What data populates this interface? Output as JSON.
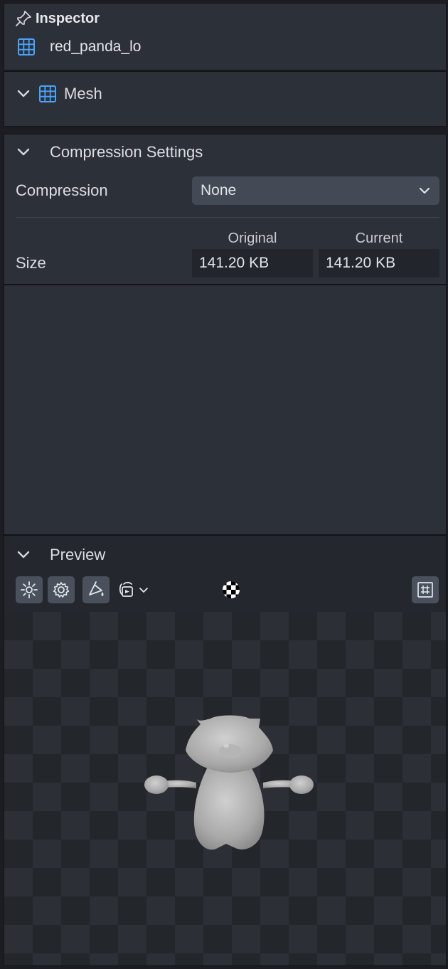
{
  "inspector": {
    "title": "Inspector",
    "asset_name": "red_panda_lo",
    "pin_icon": "pin-icon",
    "asset_icon": "mesh-grid-icon"
  },
  "mesh_section": {
    "label": "Mesh",
    "expanded": true
  },
  "compression_section": {
    "label": "Compression Settings",
    "compression_label": "Compression",
    "compression_value": "None",
    "size_label": "Size",
    "original_header": "Original",
    "current_header": "Current",
    "original_size": "141.20 KB",
    "current_size": "141.20 KB"
  },
  "preview": {
    "label": "Preview",
    "tools": [
      "sun-light-icon",
      "environment-gear-icon",
      "paint-brush-icon",
      "camera-options-icon",
      "checker-background-icon",
      "grid-toggle-icon"
    ]
  },
  "colors": {
    "panel_bg": "#2c3038",
    "accent_icon": "#4aa3ff",
    "dropdown_bg": "#434a55",
    "field_bg": "#22252b"
  }
}
